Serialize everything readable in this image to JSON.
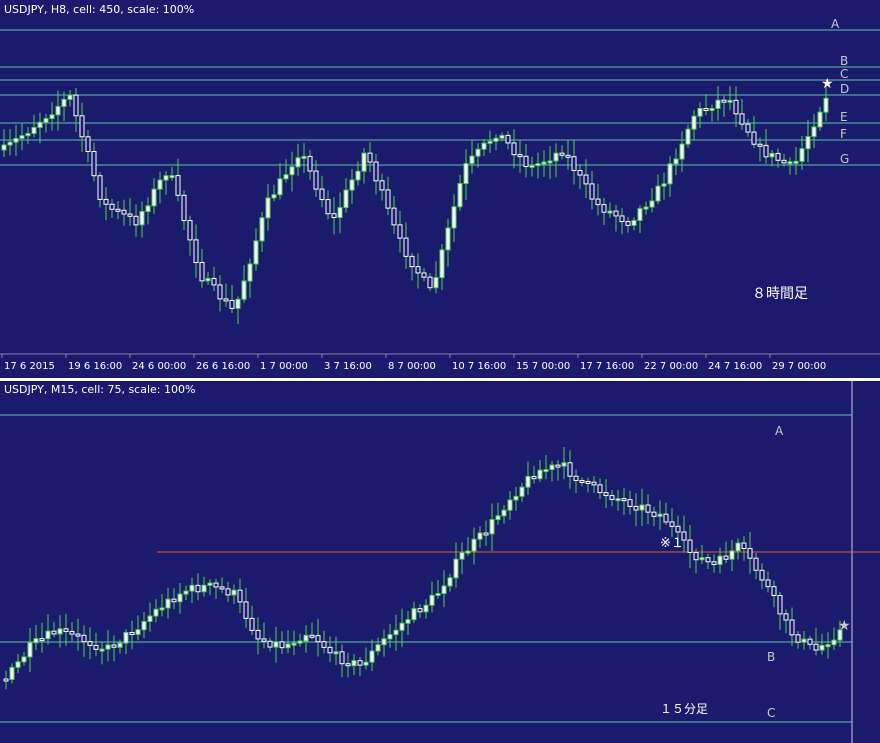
{
  "top_panel": {
    "header": "USDJPY, H8, cell: 450, scale: 100%",
    "caption": "８時間足",
    "x_ticks": [
      "17 6 2015",
      "19 6 16:00",
      "24 6 00:00",
      "26 6 16:00",
      "1 7 00:00",
      "3 7 16:00",
      "8 7 00:00",
      "10 7 16:00",
      "15 7 00:00",
      "17 7 16:00",
      "22 7 00:00",
      "24 7 16:00",
      "29 7 00:00"
    ],
    "level_labels": [
      "A",
      "B",
      "C",
      "D",
      "E",
      "F",
      "G"
    ],
    "star": "★"
  },
  "bottom_panel": {
    "header": "USDJPY, M15, cell: 75, scale: 100%",
    "caption": "１５分足",
    "note": "※１",
    "level_labels": [
      "A",
      "B",
      "C"
    ],
    "star": "★"
  },
  "colors": {
    "background": "#1b1b6e",
    "up_body": "#ffffff",
    "down_body": "#ffffff",
    "wick": "#4ed04e",
    "level_line": "#5fc0b0",
    "red_line": "#e05a3a",
    "label": "#c8c8c8",
    "separator": "#ffffff"
  },
  "chart_data": [
    {
      "type": "candlestick",
      "symbol": "USDJPY",
      "timeframe": "H8",
      "x_labels": [
        "17 6 2015",
        "19 6 16:00",
        "24 6 00:00",
        "26 6 16:00",
        "1 7 00:00",
        "3 7 16:00",
        "8 7 00:00",
        "10 7 16:00",
        "15 7 00:00",
        "17 7 16:00",
        "22 7 00:00",
        "24 7 16:00",
        "29 7 00:00"
      ],
      "close_path": [
        100,
        101.5,
        103,
        97,
        96,
        99,
        93,
        91,
        97,
        100,
        96,
        100,
        95,
        92,
        99,
        101,
        99,
        100,
        97,
        96,
        98,
        102,
        103,
        100,
        99,
        103
      ],
      "horizontal_levels": [
        "A",
        "B",
        "C",
        "D",
        "E",
        "F",
        "G"
      ]
    },
    {
      "type": "candlestick",
      "symbol": "USDJPY",
      "timeframe": "M15",
      "close_path": [
        22,
        55,
        70,
        62,
        52,
        70,
        92,
        110,
        115,
        108,
        62,
        55,
        70,
        45,
        35,
        62,
        85,
        105,
        145,
        170,
        205,
        230,
        235,
        215,
        205,
        195,
        185,
        150,
        135,
        155,
        120,
        70,
        50,
        70
      ],
      "horizontal_levels": [
        "A",
        "B",
        "C"
      ],
      "marked_level": "※１"
    }
  ]
}
